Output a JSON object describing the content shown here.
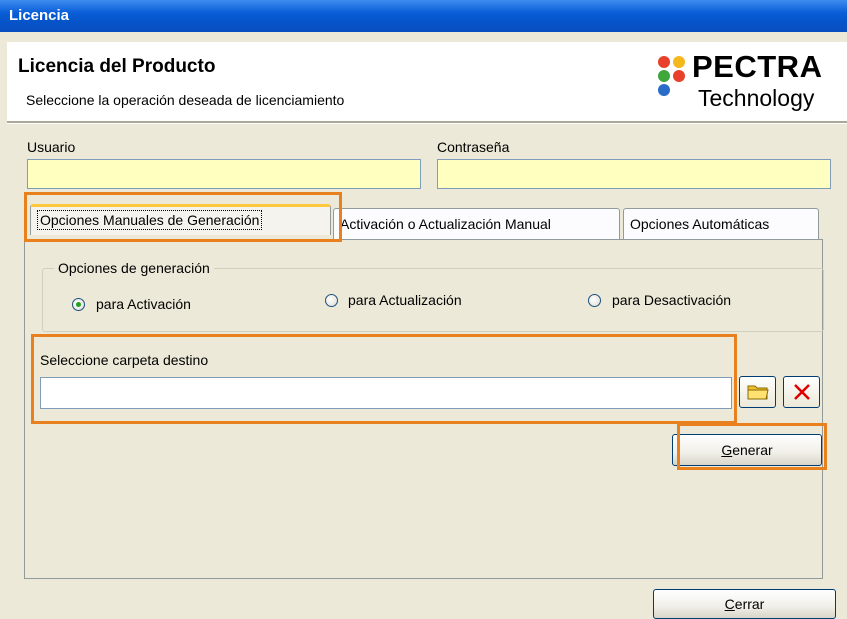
{
  "window": {
    "title": "Licencia"
  },
  "header": {
    "title": "Licencia del Producto",
    "subtitle": "Seleccione la operación deseada de licenciamiento",
    "logo_line1": "PECTRA",
    "logo_line2": "Technology"
  },
  "credentials": {
    "user_label": "Usuario",
    "user_value": "",
    "password_label": "Contraseña",
    "password_value": ""
  },
  "tabs": [
    {
      "label": "Opciones Manuales de Generación",
      "active": true
    },
    {
      "label": "Activación o Actualización Manual",
      "active": false
    },
    {
      "label": "Opciones Automáticas",
      "active": false
    }
  ],
  "generation": {
    "group_label": "Opciones de generación",
    "options": [
      {
        "label": "para Activación",
        "checked": true
      },
      {
        "label": "para Actualización",
        "checked": false
      },
      {
        "label": "para Desactivación",
        "checked": false
      }
    ]
  },
  "destination": {
    "label": "Seleccione carpeta destino",
    "value": ""
  },
  "buttons": {
    "generate_prefix": "G",
    "generate_rest": "enerar",
    "close_prefix": "C",
    "close_rest": "errar"
  },
  "colors": {
    "titlebar": "#0a5ed8",
    "highlight": "#e8801e",
    "input_yellow": "#ffffc0",
    "clear_icon": "#e00000",
    "folder_icon": "#f0c030"
  },
  "icons": {
    "browse": "folder-icon",
    "clear": "close-icon"
  }
}
